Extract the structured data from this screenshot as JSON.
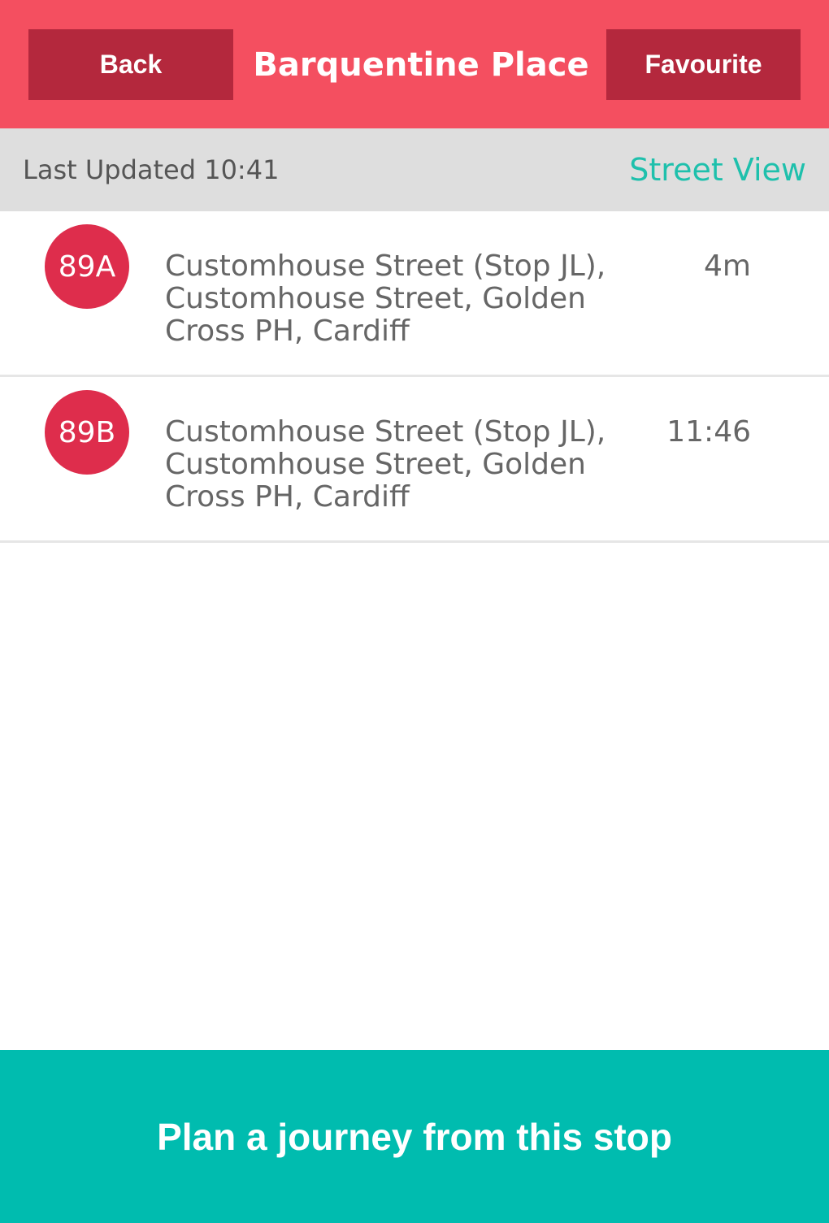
{
  "header": {
    "back_label": "Back",
    "title": "Barquentine Place",
    "favourite_label": "Favourite"
  },
  "status": {
    "last_updated": "Last Updated 10:41",
    "street_view_label": "Street View"
  },
  "departures": [
    {
      "route": "89A",
      "destination": "Customhouse Street (Stop JL), Customhouse Street, Golden Cross PH, Cardiff",
      "time": "4m"
    },
    {
      "route": "89B",
      "destination": "Customhouse Street (Stop JL), Customhouse Street, Golden Cross PH, Cardiff",
      "time": "11:46"
    }
  ],
  "footer": {
    "plan_label": "Plan a journey from this stop"
  },
  "colors": {
    "header": "#f44f60",
    "header_button": "#b4283d",
    "route_badge": "#de2d4c",
    "accent_teal": "#00bcaf"
  }
}
